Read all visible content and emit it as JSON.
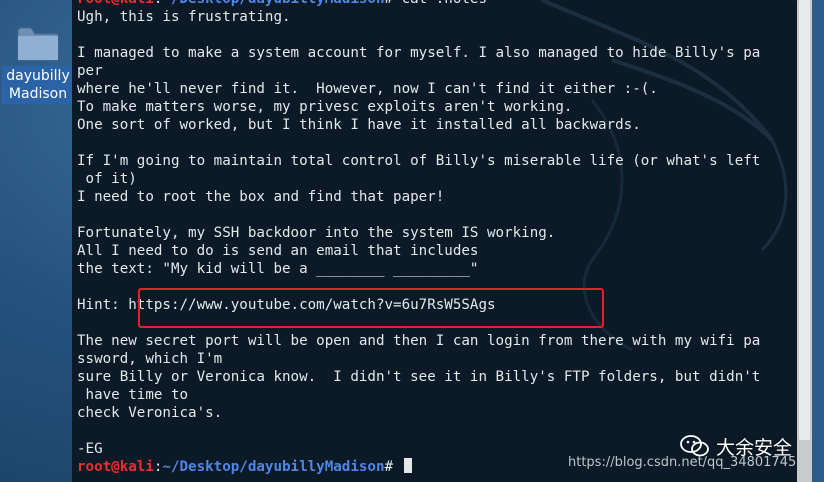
{
  "desktop": {
    "folder_label": "dayubillyMadison"
  },
  "terminal": {
    "lines": [
      {
        "text": "root@kali:~/Desktop/dayubillyMadison# cat .notes"
      },
      {
        "text": "Ugh, this is frustrating."
      },
      {
        "text": ""
      },
      {
        "text": "I managed to make a system account for myself. I also managed to hide Billy's pa"
      },
      {
        "text": "per"
      },
      {
        "text": "where he'll never find it.  However, now I can't find it either :-(."
      },
      {
        "text": "To make matters worse, my privesc exploits aren't working."
      },
      {
        "text": "One sort of worked, but I think I have it installed all backwards."
      },
      {
        "text": ""
      },
      {
        "text": "If I'm going to maintain total control of Billy's miserable life (or what's left"
      },
      {
        "text": " of it)"
      },
      {
        "text": "I need to root the box and find that paper!"
      },
      {
        "text": ""
      },
      {
        "text": "Fortunately, my SSH backdoor into the system IS working."
      },
      {
        "text": "All I need to do is send an email that includes"
      },
      {
        "text": "the text: \"My kid will be a ________ _________\""
      },
      {
        "text": ""
      },
      {
        "text": "Hint: https://www.youtube.com/watch?v=6u7RsW5SAgs"
      },
      {
        "text": ""
      },
      {
        "text": "The new secret port will be open and then I can login from there with my wifi pa"
      },
      {
        "text": "ssword, which I'm"
      },
      {
        "text": "sure Billy or Veronica know.  I didn't see it in Billy's FTP folders, but didn't"
      },
      {
        "text": " have time to"
      },
      {
        "text": "check Veronica's."
      },
      {
        "text": ""
      },
      {
        "text": "-EG"
      }
    ],
    "prompt": {
      "user": "root@kali",
      "sep": ":",
      "path": "~/Desktop/dayubillyMadison",
      "symbol": "# "
    }
  },
  "watermark": {
    "brand": "大余安全",
    "url": "https://blog.csdn.net/qq_34801745"
  },
  "colors": {
    "prompt_user": "#ee2d2d",
    "prompt_path": "#4f87e6",
    "terminal_bg": "#0b1a26",
    "highlight_border": "#e0232b"
  }
}
